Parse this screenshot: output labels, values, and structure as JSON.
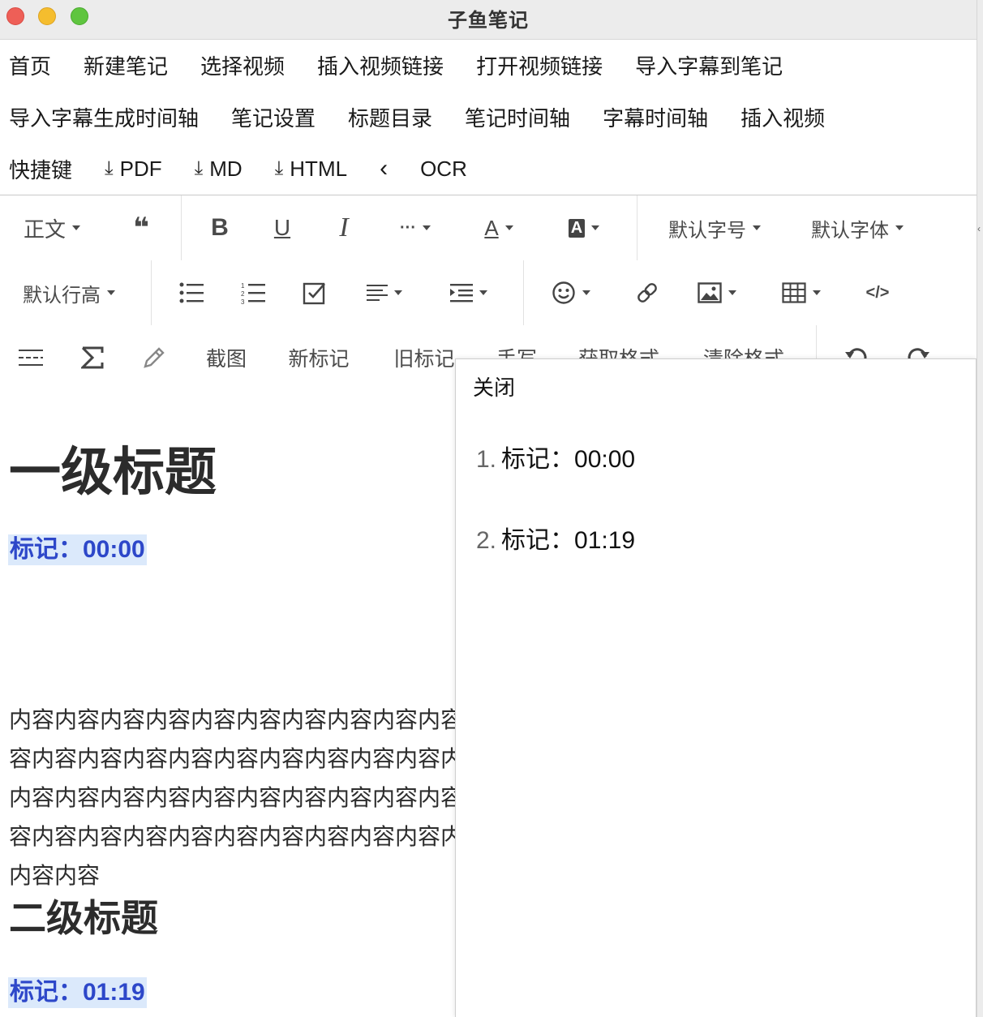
{
  "window": {
    "title": "子鱼笔记"
  },
  "menu": {
    "row1": [
      "首页",
      "新建笔记",
      "选择视频",
      "插入视频链接",
      "打开视频链接",
      "导入字幕到笔记"
    ],
    "row2": [
      "导入字幕生成时间轴",
      "笔记设置",
      "标题目录",
      "笔记时间轴",
      "字幕时间轴",
      "插入视频"
    ],
    "row3": {
      "shortcut": "快捷键",
      "pdf": "PDF",
      "md": "MD",
      "html": "HTML",
      "collapse": "‹",
      "ocr": "OCR"
    }
  },
  "toolbar": {
    "paragraph_style": "正文",
    "quote": "❝",
    "bold": "B",
    "underline": "U",
    "italic": "I",
    "more": "···",
    "font_color": "A",
    "bg_color": "A",
    "font_size": "默认字号",
    "font_family": "默认字体",
    "line_height": "默认行高",
    "screenshot": "截图",
    "new_marker": "新标记",
    "old_marker": "旧标记",
    "handwrite": "手写",
    "format_painter": "获取格式",
    "clear_format": "清除格式",
    "code_view": "</>"
  },
  "editor": {
    "h1": "一级标题",
    "marker1": "标记：00:00",
    "paragraph": "内容内容内容内容内容内容内容内容内容内容内容内容内容内容内容内容内容内容内容内容内容内容内容内容内容内容内容内容内容内容内容内容内容内容内容内容内容内容内容内容内容内容内容内容",
    "h2": "二级标题",
    "marker2": "标记：01:19"
  },
  "panel": {
    "close_label": "关闭",
    "items": [
      {
        "num": "1.",
        "label": "标记：00:00"
      },
      {
        "num": "2.",
        "label": "标记：01:19"
      }
    ]
  }
}
